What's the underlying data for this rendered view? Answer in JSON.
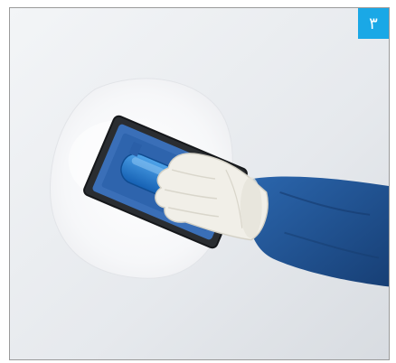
{
  "photo": {
    "subject": "gloved-hand-applying-plaster-with-float",
    "step_number": "۳",
    "colors": {
      "wall": "#e8ebef",
      "plaster": "#f7f8fa",
      "float_blade": "#2c2f33",
      "float_handle": "#1e72c8",
      "glove": "#efede6",
      "sleeve": "#1e4f8f",
      "badge": "#1aa8e6"
    }
  }
}
